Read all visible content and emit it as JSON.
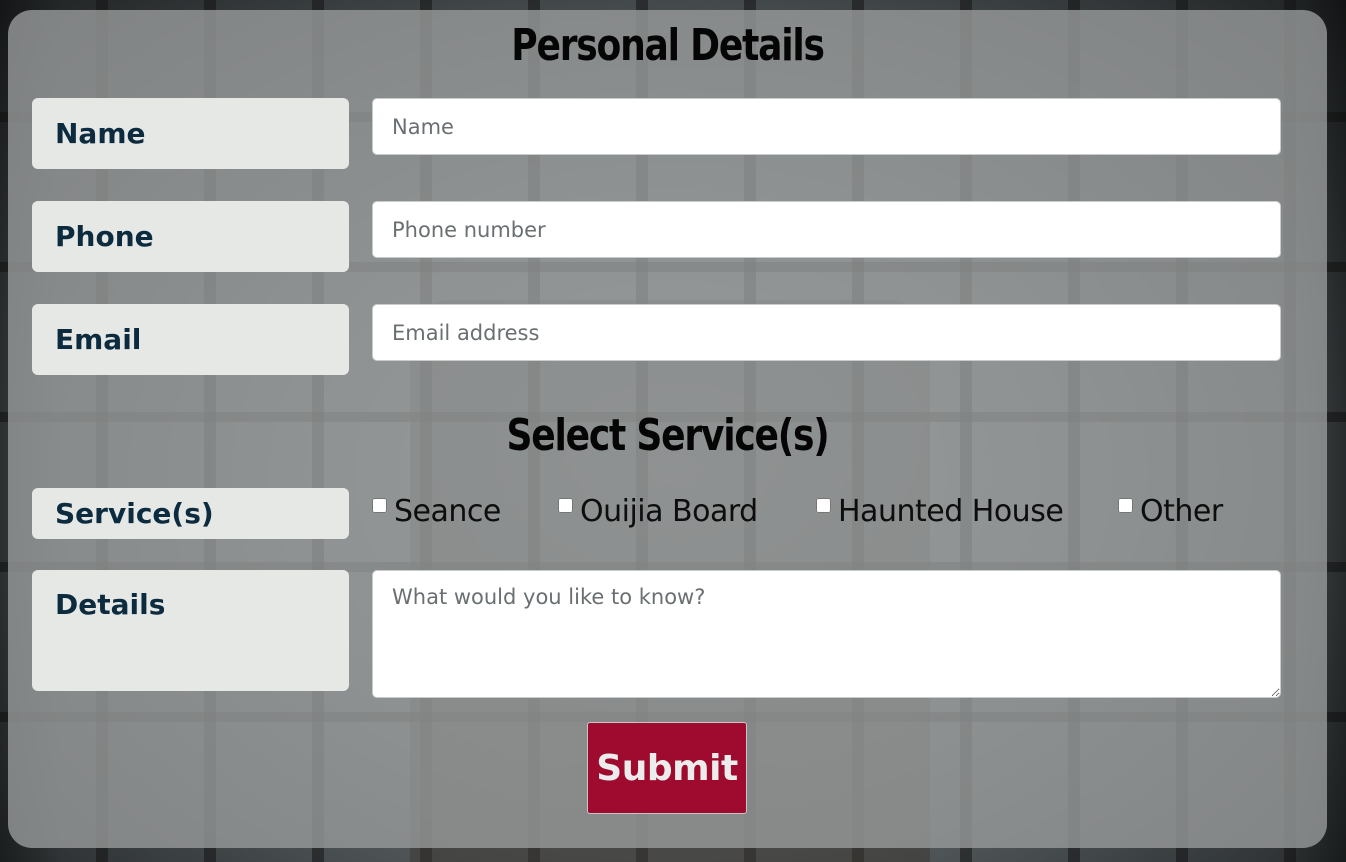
{
  "personal_section": {
    "title": "Personal Details"
  },
  "fields": {
    "name": {
      "label": "Name",
      "placeholder": "Name",
      "value": ""
    },
    "phone": {
      "label": "Phone",
      "placeholder": "Phone number",
      "value": ""
    },
    "email": {
      "label": "Email",
      "placeholder": "Email address",
      "value": ""
    }
  },
  "services_section": {
    "title": "Select Service(s)",
    "label": "Service(s)",
    "options": [
      {
        "label": "Seance",
        "checked": false
      },
      {
        "label": "Ouijia Board",
        "checked": false
      },
      {
        "label": "Haunted House",
        "checked": false
      },
      {
        "label": "Other",
        "checked": false
      }
    ]
  },
  "details": {
    "label": "Details",
    "placeholder": "What would you like to know?",
    "value": ""
  },
  "submit": {
    "label": "Submit"
  },
  "colors": {
    "label_text": "#0c2b3f",
    "label_bg": "#e6e8e6",
    "submit_bg": "#9e0b2f",
    "card_bg": "#969999"
  }
}
